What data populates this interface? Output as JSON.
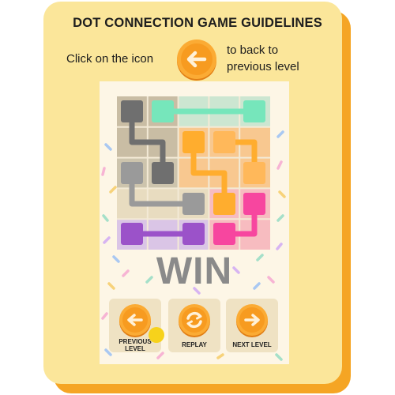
{
  "guide": {
    "title": "DOT CONNECTION GAME GUIDELINES",
    "instruction_left": "Click on the icon",
    "instruction_right_line1": "to back to",
    "instruction_right_line2": "previous level",
    "instruction_icon": "back-arrow-icon"
  },
  "game": {
    "grid_size": "5x5",
    "status_text": "WIN",
    "pipes": [
      {
        "color": "#76e6bb",
        "name": "green"
      },
      {
        "color": "#7d7d7d",
        "name": "dark-gray"
      },
      {
        "color": "#9a9a9a",
        "name": "light-gray"
      },
      {
        "color": "#ffad2e",
        "name": "orange"
      },
      {
        "color": "#f7463f",
        "name": "pink"
      },
      {
        "color": "#9b52c9",
        "name": "purple"
      }
    ],
    "buttons": {
      "previous_level_line1": "PREVIOUS",
      "previous_level_line2": "LEVEL",
      "replay": "REPLAY",
      "next_level": "NEXT LEVEL"
    }
  },
  "colors": {
    "card": "#fbe69a",
    "card_shadow": "#f5a524",
    "icon_orange": "#f9a42c"
  }
}
